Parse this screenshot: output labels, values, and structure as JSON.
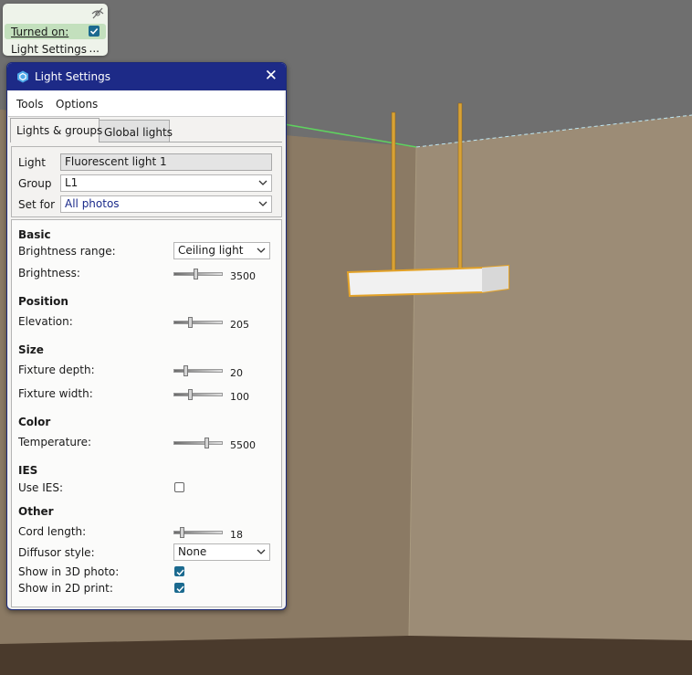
{
  "mini_panel": {
    "turned_on_label": "Turned on:",
    "turned_on": true,
    "light_settings_label": "Light Settings",
    "more_label": "..."
  },
  "dialog": {
    "title": "Light Settings",
    "menu": [
      "Tools",
      "Options"
    ],
    "tabs": [
      "Lights & groups",
      "Global lights"
    ],
    "active_tab": 0,
    "light": {
      "label": "Light",
      "value": "Fluorescent light 1"
    },
    "group": {
      "label": "Group",
      "value": "L1"
    },
    "set_for": {
      "label": "Set for",
      "value": "All photos"
    },
    "basic": {
      "heading": "Basic",
      "brightness_range_label": "Brightness range:",
      "brightness_range_value": "Ceiling light",
      "brightness_label": "Brightness:",
      "brightness_value": "3500",
      "brightness_pos": 0.45
    },
    "position": {
      "heading": "Position",
      "elevation_label": "Elevation:",
      "elevation_value": "205",
      "elevation_pos": 0.32
    },
    "size": {
      "heading": "Size",
      "depth_label": "Fixture depth:",
      "depth_value": "20",
      "depth_pos": 0.22,
      "width_label": "Fixture width:",
      "width_value": "100",
      "width_pos": 0.32
    },
    "color": {
      "heading": "Color",
      "temperature_label": "Temperature:",
      "temperature_value": "5500",
      "temperature_pos": 0.7
    },
    "ies": {
      "heading": "IES",
      "use_ies_label": "Use IES:",
      "use_ies": false
    },
    "other": {
      "heading": "Other",
      "cord_label": "Cord length:",
      "cord_value": "18",
      "cord_pos": 0.15,
      "diffusor_label": "Diffusor style:",
      "diffusor_value": "None",
      "show3d_label": "Show in 3D photo:",
      "show3d": true,
      "show2d_label": "Show in 2D print:",
      "show2d": true
    }
  },
  "colors": {
    "title_bar": "#1d2a87",
    "accent_check": "#1b6a8f",
    "fixture_outline": "#e3a228",
    "wall": "#8a7a64",
    "ceiling": "#6e6e6e"
  }
}
